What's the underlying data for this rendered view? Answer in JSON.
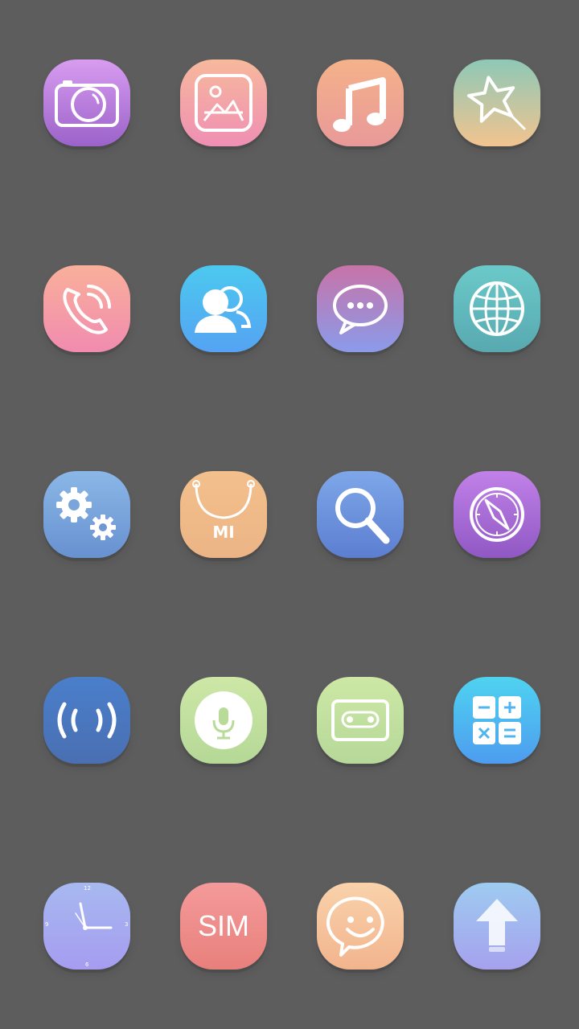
{
  "screen": {
    "background": "#5d5d5d"
  },
  "apps": [
    {
      "icon": "camera-icon",
      "gradient": [
        "#d89cf0",
        "#9b62c9"
      ]
    },
    {
      "icon": "gallery-icon",
      "gradient": [
        "#f7b99c",
        "#ef8fb4"
      ]
    },
    {
      "icon": "music-icon",
      "gradient": [
        "#f4b28a",
        "#e99999"
      ]
    },
    {
      "icon": "themes-icon",
      "gradient": [
        "#8ec8b6",
        "#f2c48f"
      ]
    },
    {
      "icon": "phone-icon",
      "gradient": [
        "#f9b09a",
        "#f18bb0"
      ]
    },
    {
      "icon": "contacts-icon",
      "gradient": [
        "#4cc9ef",
        "#55a3f3"
      ]
    },
    {
      "icon": "messaging-icon",
      "gradient": [
        "#c873a8",
        "#8a9bea"
      ]
    },
    {
      "icon": "browser-icon",
      "gradient": [
        "#6bc9c9",
        "#58a9b0"
      ]
    },
    {
      "icon": "settings-icon",
      "gradient": [
        "#8ab7e7",
        "#6891d0"
      ]
    },
    {
      "icon": "mi-store-icon",
      "gradient": [
        "#f3c08c",
        "#ecb485"
      ],
      "label": "MI"
    },
    {
      "icon": "search-icon",
      "gradient": [
        "#7ea7e8",
        "#5c7ed1"
      ]
    },
    {
      "icon": "compass-icon",
      "gradient": [
        "#c181e8",
        "#9058c4"
      ]
    },
    {
      "icon": "fm-radio-icon",
      "gradient": [
        "#4a7fcb",
        "#4a6fb2"
      ]
    },
    {
      "icon": "recorder-icon",
      "gradient": [
        "#cde7a6",
        "#b5d897"
      ]
    },
    {
      "icon": "cassette-icon",
      "gradient": [
        "#cde8a4",
        "#b6d89a"
      ]
    },
    {
      "icon": "calculator-icon",
      "gradient": [
        "#4fd3f0",
        "#4d9cef"
      ]
    },
    {
      "icon": "clock-icon",
      "gradient": [
        "#a7b9f0",
        "#a69cf0"
      ],
      "numerals": [
        "12",
        "3",
        "6",
        "9"
      ]
    },
    {
      "icon": "sim-toolkit-icon",
      "gradient": [
        "#f49a9a",
        "#e8807c"
      ],
      "label": "SIM"
    },
    {
      "icon": "feedback-icon",
      "gradient": [
        "#f9d2ab",
        "#f2b48d"
      ]
    },
    {
      "icon": "updater-icon",
      "gradient": [
        "#9ecbf0",
        "#a6a1ee"
      ]
    }
  ]
}
